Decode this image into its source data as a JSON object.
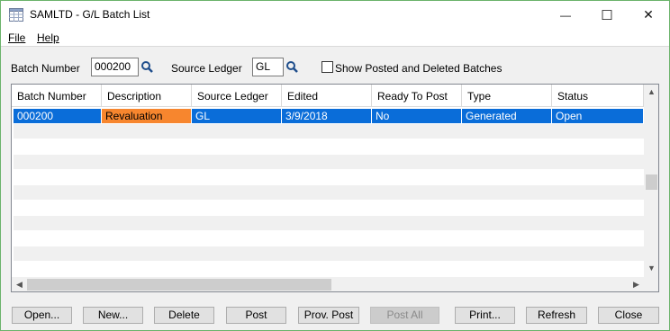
{
  "window": {
    "title": "SAMLTD - G/L Batch List",
    "minimize_glyph": "—",
    "maximize_glyph": "☐",
    "close_glyph": "✕",
    "app_icon": "table-grid-icon"
  },
  "menu": {
    "file": "File",
    "help": "Help"
  },
  "filters": {
    "batch_number_label": "Batch Number",
    "batch_number_value": "000200",
    "source_ledger_label": "Source Ledger",
    "source_ledger_value": "GL",
    "show_posted_label": "Show Posted and Deleted Batches",
    "show_posted_checked": false,
    "finder_icon": "magnifier-icon"
  },
  "grid": {
    "columns": [
      "Batch Number",
      "Description",
      "Source Ledger",
      "Edited",
      "Ready To Post",
      "Type",
      "Status"
    ],
    "rows": [
      [
        "000200",
        "Revaluation",
        "GL",
        "3/9/2018",
        "No",
        "Generated",
        "Open"
      ]
    ],
    "selected_row": 0,
    "highlighted_cell_color": "#f7862e",
    "selection_color": "#0a6dd9"
  },
  "buttons": {
    "open": "Open...",
    "new": "New...",
    "delete": "Delete",
    "post": "Post",
    "prov_post": "Prov. Post",
    "post_all": "Post All",
    "print": "Print...",
    "refresh": "Refresh",
    "close": "Close"
  }
}
